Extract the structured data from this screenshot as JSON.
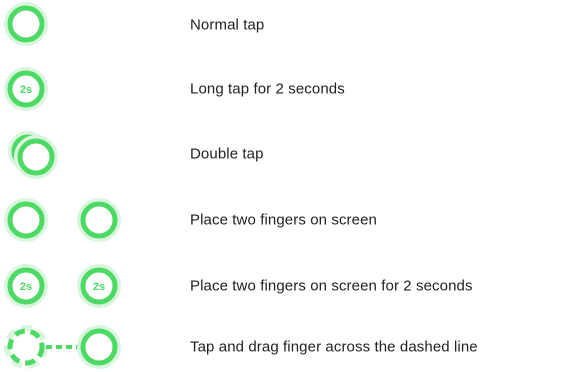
{
  "colors": {
    "ring": "#4cd964",
    "ring_glow": "#d9f5de",
    "ring_fill": "#ffffff",
    "text": "#1f1f1f"
  },
  "gestures": [
    {
      "label": "Normal tap",
      "icon": "single-tap-icon"
    },
    {
      "label": "Long tap for 2 seconds",
      "icon": "long-tap-icon",
      "duration": "2s"
    },
    {
      "label": "Double tap",
      "icon": "double-tap-icon"
    },
    {
      "label": "Place two fingers on screen",
      "icon": "two-finger-tap-icon"
    },
    {
      "label": "Place two fingers on screen for 2 seconds",
      "icon": "two-finger-long-tap-icon",
      "duration": "2s"
    },
    {
      "label": "Tap and drag finger across the dashed line",
      "icon": "tap-and-drag-icon"
    }
  ]
}
